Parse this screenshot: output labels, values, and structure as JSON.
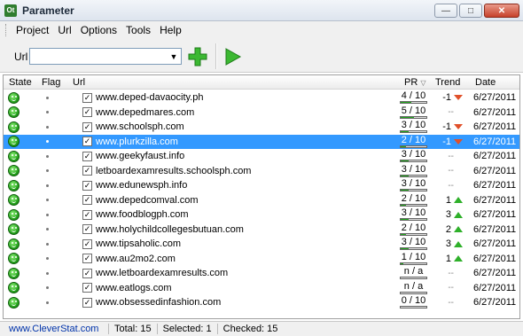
{
  "window": {
    "title": "Parameter",
    "icon": "app-icon",
    "icon_text": "Ot"
  },
  "menu": [
    "Project",
    "Url",
    "Options",
    "Tools",
    "Help"
  ],
  "toolbar": {
    "url_label": "Url",
    "url_value": "",
    "add_icon": "plus-icon",
    "go_icon": "play-icon"
  },
  "columns": {
    "state": "State",
    "flag": "Flag",
    "url": "Url",
    "pr": "PR",
    "trend": "Trend",
    "date": "Date"
  },
  "rows": [
    {
      "url": "www.deped-davaocity.ph",
      "pr": "4 / 10",
      "pr_value": 0.4,
      "trend": "-1",
      "dir": "down",
      "date": "6/27/2011",
      "checked": true,
      "selected": false
    },
    {
      "url": "www.depedmares.com",
      "pr": "5 / 10",
      "pr_value": 0.5,
      "trend": "",
      "dir": "none",
      "date": "6/27/2011",
      "checked": true,
      "selected": false
    },
    {
      "url": "www.schoolsph.com",
      "pr": "3 / 10",
      "pr_value": 0.3,
      "trend": "-1",
      "dir": "down",
      "date": "6/27/2011",
      "checked": true,
      "selected": false
    },
    {
      "url": "www.plurkzilla.com",
      "pr": "2 / 10",
      "pr_value": 0.2,
      "trend": "-1",
      "dir": "down",
      "date": "6/27/2011",
      "checked": true,
      "selected": true
    },
    {
      "url": "www.geekyfaust.info",
      "pr": "3 / 10",
      "pr_value": 0.3,
      "trend": "",
      "dir": "none",
      "date": "6/27/2011",
      "checked": true,
      "selected": false
    },
    {
      "url": "letboardexamresults.schoolsph.com",
      "pr": "3 / 10",
      "pr_value": 0.3,
      "trend": "",
      "dir": "none",
      "date": "6/27/2011",
      "checked": true,
      "selected": false
    },
    {
      "url": "www.edunewsph.info",
      "pr": "3 / 10",
      "pr_value": 0.3,
      "trend": "",
      "dir": "none",
      "date": "6/27/2011",
      "checked": true,
      "selected": false
    },
    {
      "url": "www.depedcomval.com",
      "pr": "2 / 10",
      "pr_value": 0.2,
      "trend": "1",
      "dir": "up",
      "date": "6/27/2011",
      "checked": true,
      "selected": false
    },
    {
      "url": "www.foodblogph.com",
      "pr": "3 / 10",
      "pr_value": 0.3,
      "trend": "3",
      "dir": "up",
      "date": "6/27/2011",
      "checked": true,
      "selected": false
    },
    {
      "url": "www.holychildcollegesbutuan.com",
      "pr": "2 / 10",
      "pr_value": 0.2,
      "trend": "2",
      "dir": "up",
      "date": "6/27/2011",
      "checked": true,
      "selected": false
    },
    {
      "url": "www.tipsaholic.com",
      "pr": "3 / 10",
      "pr_value": 0.3,
      "trend": "3",
      "dir": "up",
      "date": "6/27/2011",
      "checked": true,
      "selected": false
    },
    {
      "url": "www.au2mo2.com",
      "pr": "1 / 10",
      "pr_value": 0.1,
      "trend": "1",
      "dir": "up",
      "date": "6/27/2011",
      "checked": true,
      "selected": false
    },
    {
      "url": "www.letboardexamresults.com",
      "pr": "n / a",
      "pr_value": 0,
      "trend": "",
      "dir": "none",
      "date": "6/27/2011",
      "checked": true,
      "selected": false
    },
    {
      "url": "www.eatlogs.com",
      "pr": "n / a",
      "pr_value": 0,
      "trend": "",
      "dir": "none",
      "date": "6/27/2011",
      "checked": true,
      "selected": false
    },
    {
      "url": "www.obsessedinfashion.com",
      "pr": "0 / 10",
      "pr_value": 0,
      "trend": "",
      "dir": "none",
      "date": "6/27/2011",
      "checked": true,
      "selected": false
    }
  ],
  "status": {
    "link": "www.CleverStat.com",
    "total": "Total: 15",
    "selected": "Selected: 1",
    "checked": "Checked: 15"
  }
}
